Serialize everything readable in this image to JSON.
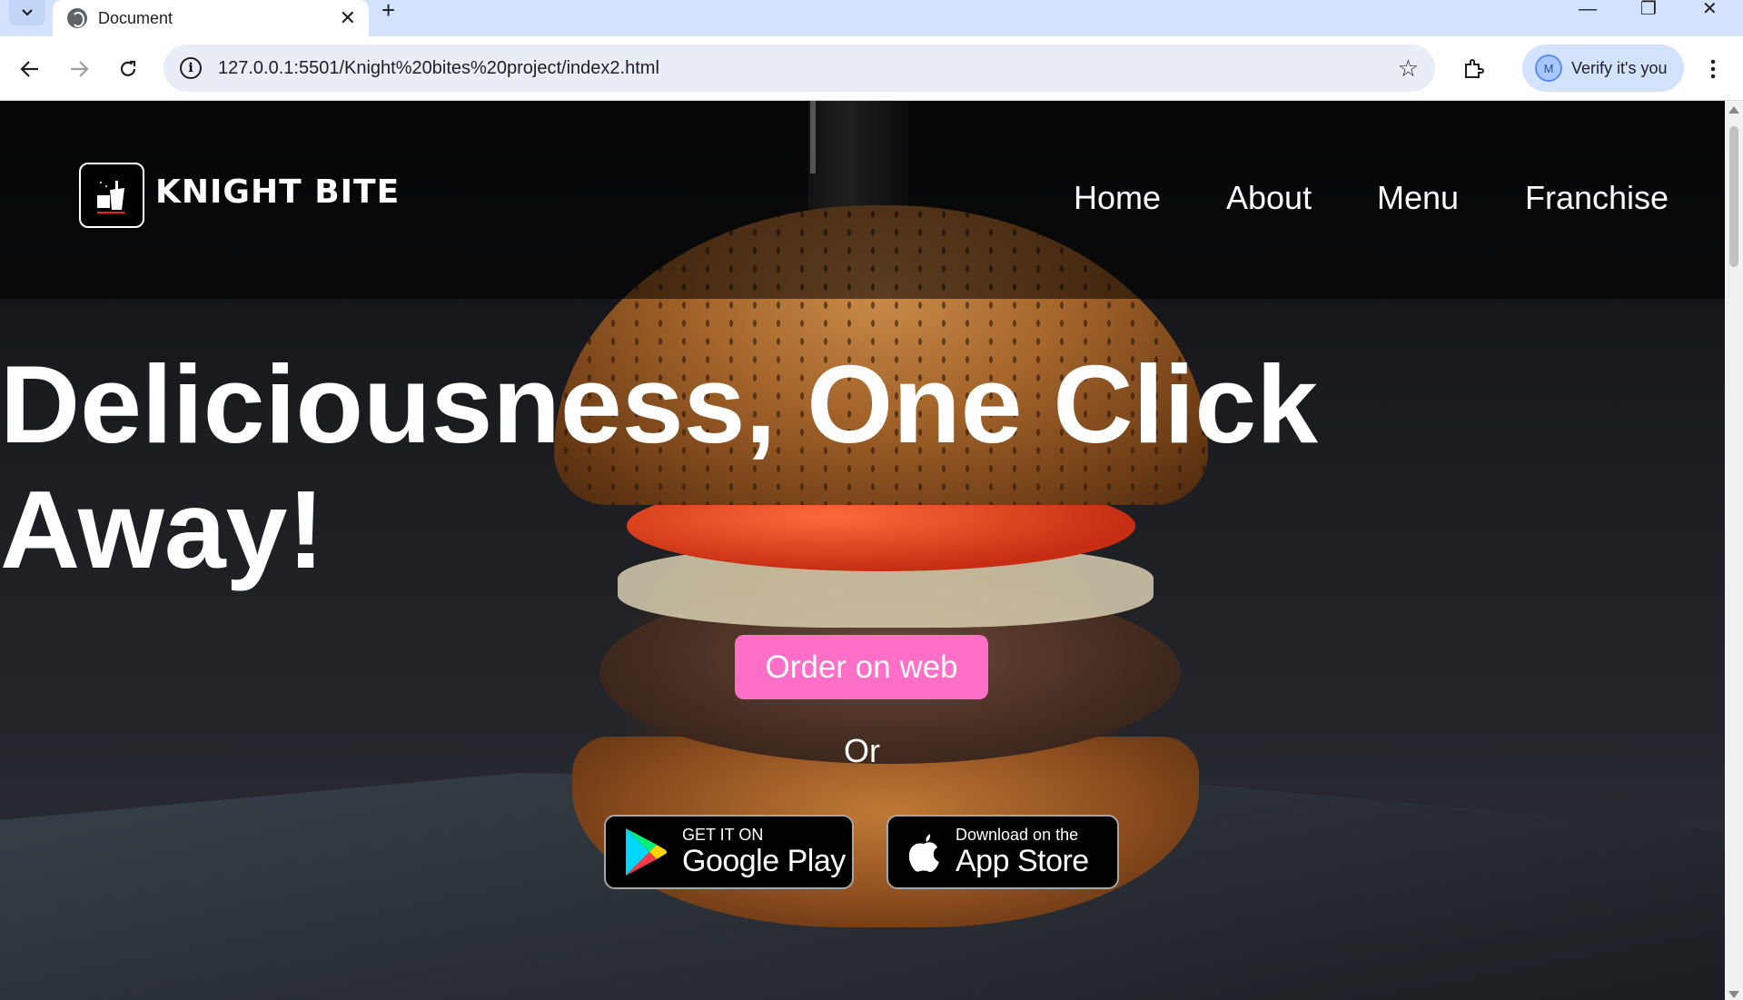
{
  "browser": {
    "tab_title": "Document",
    "tab_close": "✕",
    "new_tab": "+",
    "url": "127.0.0.1:5501/Knight%20bites%20project/index2.html",
    "profile_initial": "M",
    "profile_label": "Verify it's you",
    "window_controls": {
      "minimize": "—",
      "restore": "❐",
      "close": "✕"
    }
  },
  "site": {
    "brand": "KNIGHT BITE",
    "nav": [
      "Home",
      "About",
      "Menu",
      "Franchise"
    ],
    "headline": "Deliciousness, One Click Away!",
    "order_button": "Order on web",
    "or_text": "Or",
    "google_play": {
      "small": "GET IT ON",
      "big": "Google Play"
    },
    "app_store": {
      "small": "Download on the",
      "big": "App Store"
    },
    "colors": {
      "order_button": "#ff6ec7",
      "brand_text": "#ffffff",
      "logo_accent": "#e02424"
    }
  }
}
